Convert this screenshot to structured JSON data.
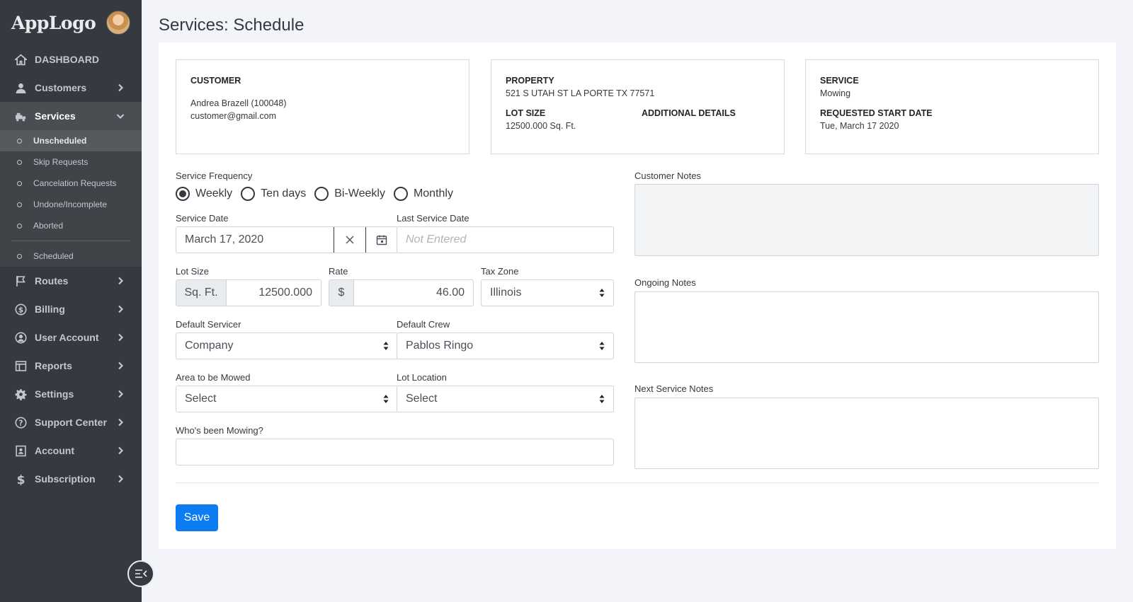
{
  "app": {
    "logo": "AppLogo"
  },
  "sidebar": {
    "items": [
      {
        "label": "DASHBOARD",
        "icon": "home-icon"
      },
      {
        "label": "Customers",
        "icon": "user-icon"
      },
      {
        "label": "Services",
        "icon": "truck-mower-icon"
      },
      {
        "label": "Routes",
        "icon": "flag-icon"
      },
      {
        "label": "Billing",
        "icon": "dollar-circle-icon"
      },
      {
        "label": "User Account",
        "icon": "user-circle-icon"
      },
      {
        "label": "Reports",
        "icon": "table-icon"
      },
      {
        "label": "Settings",
        "icon": "gear-icon"
      },
      {
        "label": "Support Center",
        "icon": "help-icon"
      },
      {
        "label": "Account",
        "icon": "id-card-icon"
      },
      {
        "label": "Subscription",
        "icon": "dollar-icon"
      }
    ],
    "services_sub": [
      "Unscheduled",
      "Skip Requests",
      "Cancelation Requests",
      "Undone/Incomplete",
      "Aborted",
      "Scheduled"
    ]
  },
  "page": {
    "title": "Services: Schedule"
  },
  "customer": {
    "label": "CUSTOMER",
    "name": "Andrea Brazell (100048)",
    "email": "customer@gmail.com"
  },
  "property": {
    "label": "PROPERTY",
    "address": "521 S UTAH ST LA PORTE TX 77571",
    "lot_size_label": "LOT SIZE",
    "lot_size": "12500.000 Sq. Ft.",
    "additional_label": "ADDITIONAL DETAILS"
  },
  "service": {
    "label": "SERVICE",
    "name": "Mowing",
    "start_label": "REQUESTED START DATE",
    "start_date": "Tue, March 17 2020"
  },
  "form": {
    "frequency_label": "Service Frequency",
    "frequency_options": [
      "Weekly",
      "Ten days",
      "Bi-Weekly",
      "Monthly"
    ],
    "frequency_selected": "Weekly",
    "service_date_label": "Service Date",
    "service_date": "March 17, 2020",
    "last_service_label": "Last Service Date",
    "last_service_placeholder": "Not Entered",
    "lot_size_label": "Lot Size",
    "lot_unit": "Sq. Ft.",
    "lot_value": "12500.000",
    "rate_label": "Rate",
    "rate_prefix": "$",
    "rate_value": "46.00",
    "tax_zone_label": "Tax Zone",
    "tax_zone": "Illinois",
    "servicer_label": "Default Servicer",
    "servicer": "Company",
    "crew_label": "Default Crew",
    "crew": "Pablos Ringo",
    "area_label": "Area to be Mowed",
    "area": "Select",
    "location_label": "Lot Location",
    "location": "Select",
    "mowing_label": "Who's been Mowing?",
    "mowing_value": "",
    "customer_notes_label": "Customer Notes",
    "ongoing_notes_label": "Ongoing Notes",
    "next_notes_label": "Next Service Notes",
    "save_label": "Save"
  },
  "colors": {
    "sidebar": "#343a40",
    "primary": "#0d7bf2",
    "background": "#f3f4fa"
  }
}
